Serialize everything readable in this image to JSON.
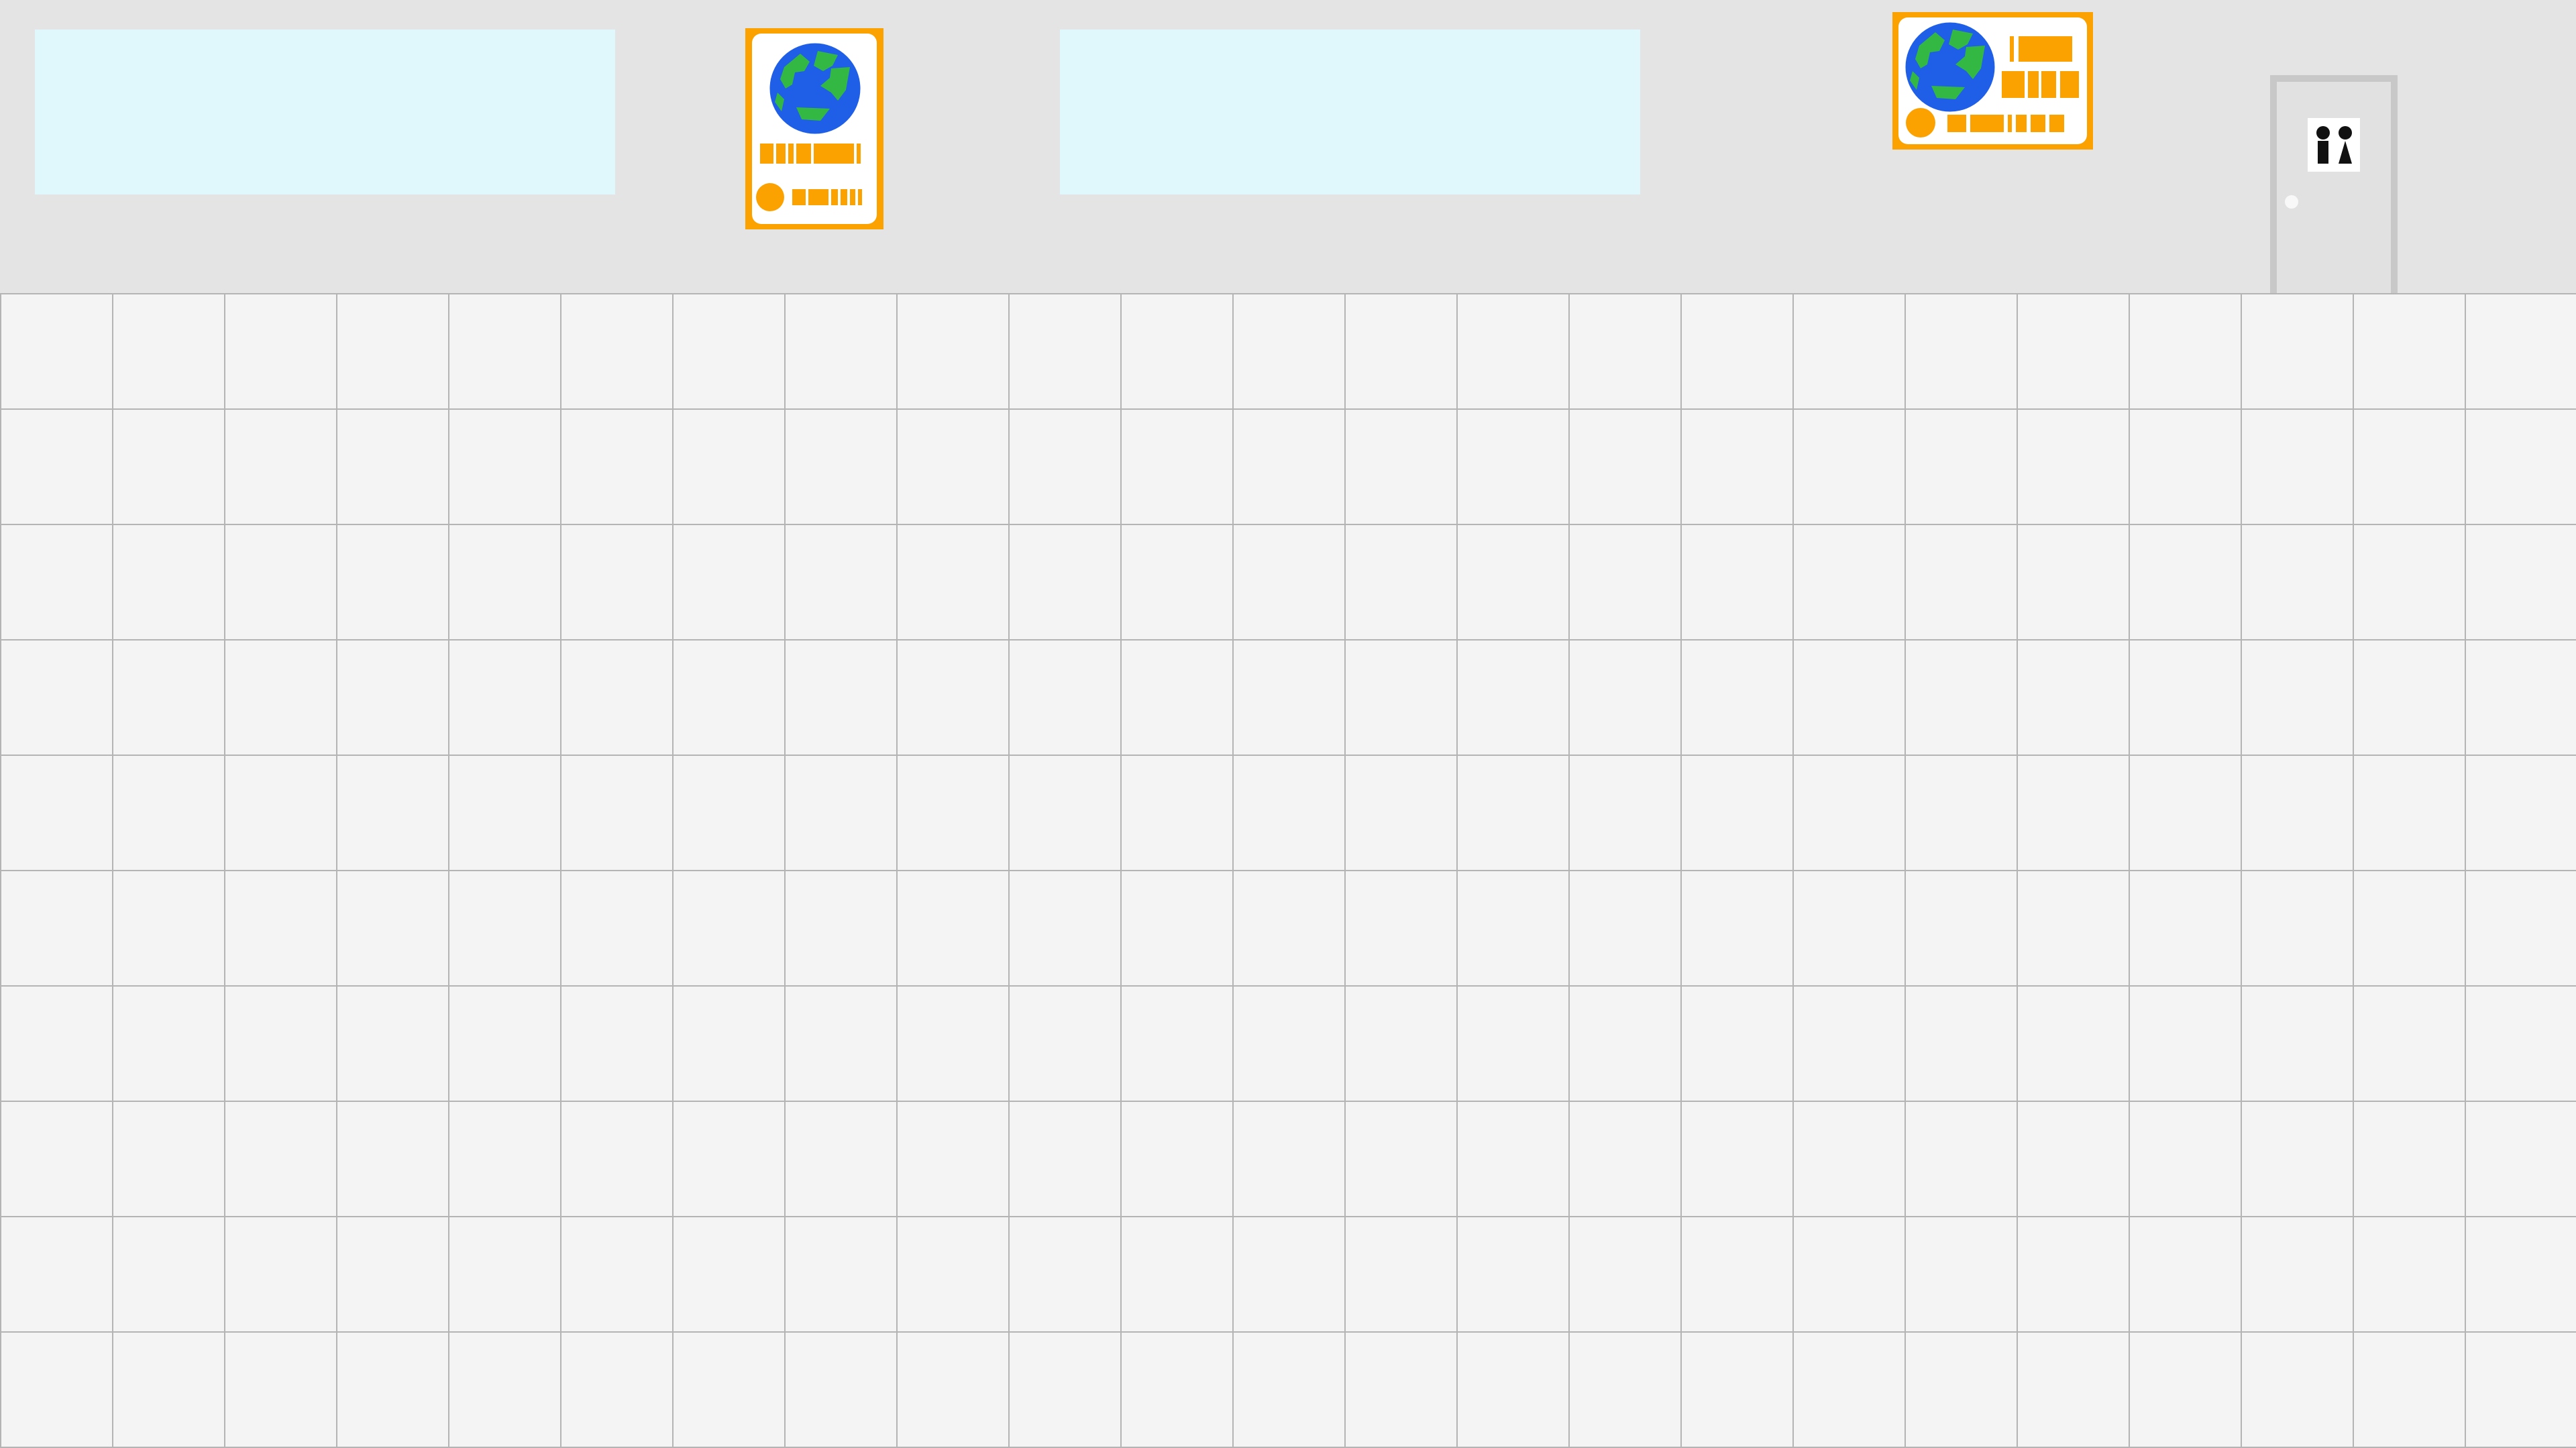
{
  "scene": {
    "type": "room",
    "colors": {
      "wall": "#e4e4e4",
      "floor_tile": "#f4f4f4",
      "floor_grid": "#b4b4b4",
      "window_glass": "#e0f8fc",
      "poster_frame": "#fba200",
      "poster_inner": "#ffffff",
      "globe_ocean": "#1f5fe8",
      "globe_land": "#33b843",
      "door_frame": "#c8c8c8",
      "door_panel": "#e1e1e1",
      "door_handle": "#f8f8f8",
      "restroom_sign_bg": "#ffffff",
      "restroom_sign_figures": "#111111"
    },
    "windows": [
      {
        "name": "window-left"
      },
      {
        "name": "window-middle"
      }
    ],
    "posters": [
      {
        "name": "poster-portrait",
        "icon": "globe-icon",
        "orientation": "portrait"
      },
      {
        "name": "poster-landscape",
        "icon": "globe-icon",
        "orientation": "landscape"
      }
    ],
    "door": {
      "name": "restroom-door",
      "sign_icon": "restroom-sign-icon"
    }
  }
}
